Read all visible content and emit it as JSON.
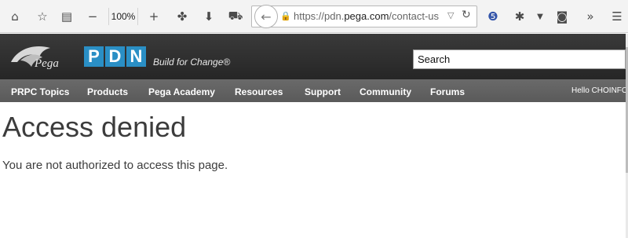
{
  "browser": {
    "zoom": "100%",
    "url_prefix": "https://pdn.",
    "url_domain": "pega.com",
    "url_path": "/contact-us",
    "icons": [
      "home-icon",
      "star-icon",
      "reading-list-icon",
      "zoom-out-icon",
      "zoom-in-icon",
      "extension-icon",
      "download-icon",
      "sync-icon",
      "back-icon",
      "lock-icon",
      "url-dropdown-icon",
      "reload-icon",
      "addon-icon",
      "bug-icon",
      "chevron-down-icon",
      "mask-icon",
      "overflow-icon",
      "menu-icon"
    ]
  },
  "header": {
    "logo_text": "Pega",
    "pdn_letters": [
      "P",
      "D",
      "N"
    ],
    "tagline": "Build for Change®",
    "search_placeholder": "Search"
  },
  "nav": {
    "items": [
      "PRPC Topics",
      "Products",
      "Pega Academy",
      "Resources",
      "Support",
      "Community",
      "Forums"
    ],
    "greeting": "Hello CHOINFO"
  },
  "content": {
    "title": "Access denied",
    "message": "You are not authorized to access this page."
  },
  "colors": {
    "header_bg": "#2e2e2e",
    "nav_bg": "#626262",
    "pdn_blue": "#2a8fc5"
  }
}
